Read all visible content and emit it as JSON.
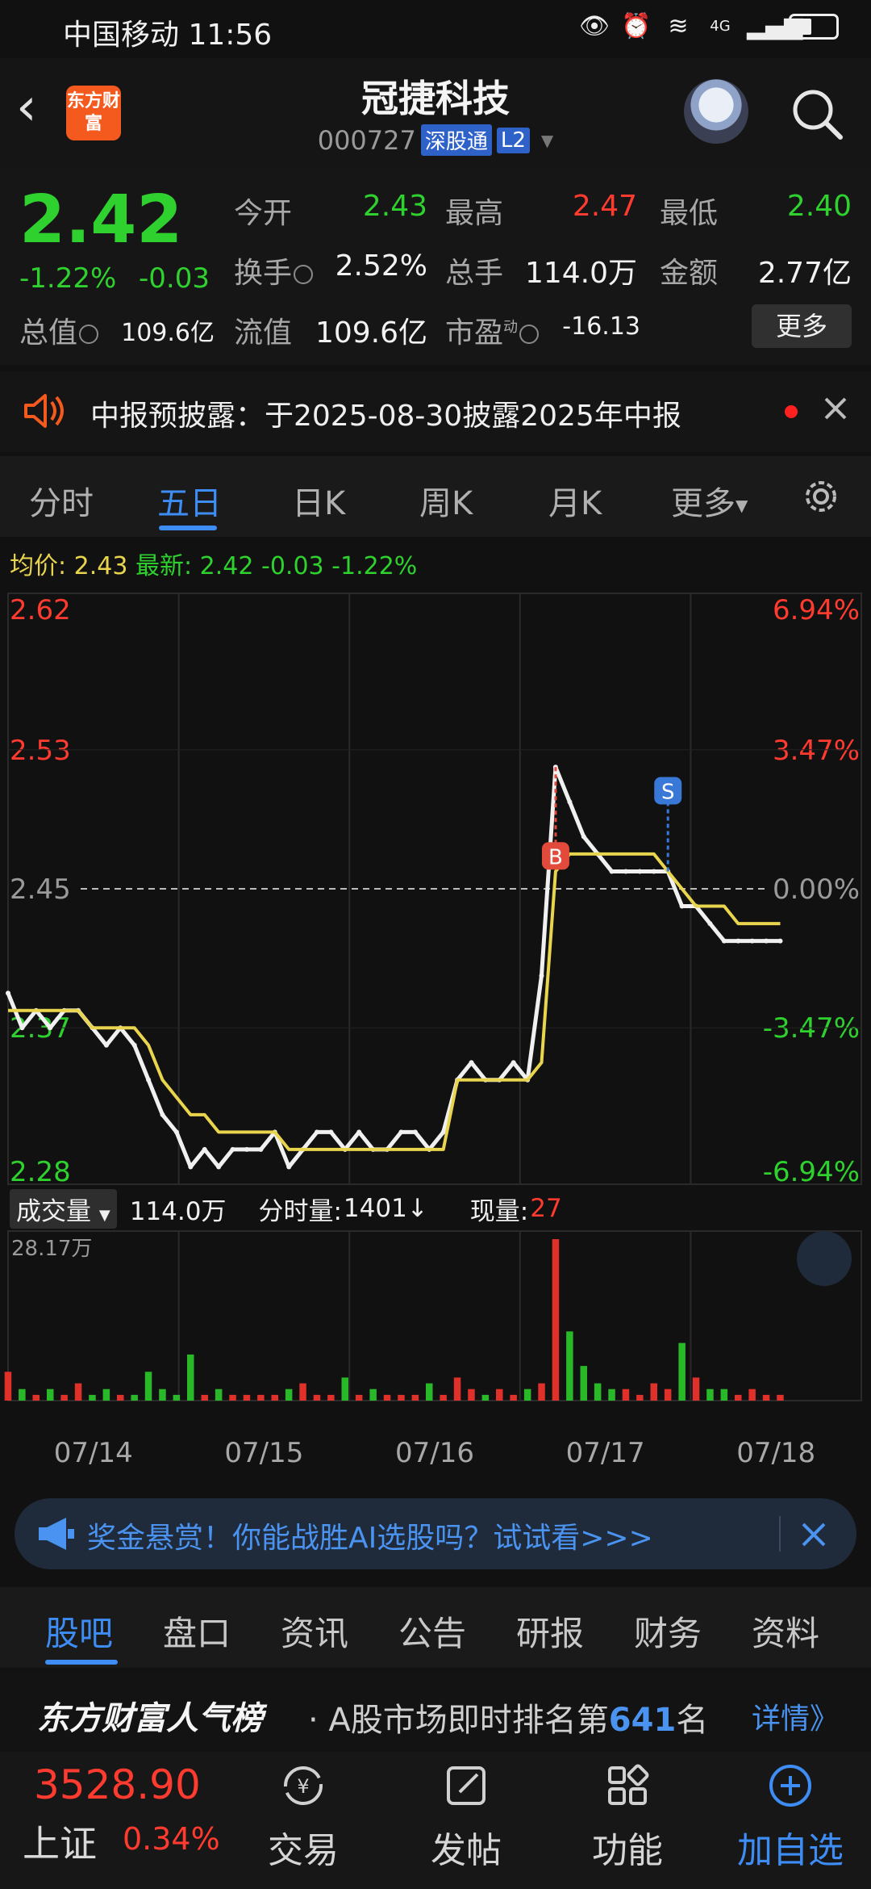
{
  "status_bar": {
    "carrier_time": "中国移动 11:56",
    "network": "4G"
  },
  "header": {
    "logo_text": "东方财富",
    "stock_name": "冠捷科技",
    "stock_code": "000727",
    "tag_connect": "深股通",
    "tag_level": "L2"
  },
  "quote": {
    "last": "2.42",
    "pct": "-1.22%",
    "chg": "-0.03",
    "open_label": "今开",
    "open": "2.43",
    "high_label": "最高",
    "high": "2.47",
    "low_label": "最低",
    "low": "2.40",
    "turnover_label": "换手",
    "turnover": "2.52%",
    "volume_label": "总手",
    "volume": "114.0万",
    "amount_label": "金额",
    "amount": "2.77亿",
    "mktcap_label": "总值",
    "mktcap": "109.6亿",
    "float_label": "流值",
    "float": "109.6亿",
    "pe_label": "市盈",
    "pe_sup": "动",
    "pe": "-16.13",
    "more_label": "更多"
  },
  "notice": {
    "text": "中报预披露：于2025-08-30披露2025年中报"
  },
  "chart_tabs": [
    {
      "label": "分时"
    },
    {
      "label": "五日"
    },
    {
      "label": "日K"
    },
    {
      "label": "周K"
    },
    {
      "label": "月K"
    },
    {
      "label": "更多"
    }
  ],
  "avg_row": {
    "avg_label": "均价:",
    "avg": "2.43",
    "latest_label": "最新:",
    "latest": "2.42",
    "chg": "-0.03",
    "pct": "-1.22%"
  },
  "chart_data": {
    "type": "line",
    "title": "",
    "y_left_ticks": [
      "2.62",
      "2.53",
      "2.45",
      "2.37",
      "2.28"
    ],
    "y_right_ticks": [
      "6.94%",
      "3.47%",
      "0.00%",
      "-3.47%",
      "-6.94%"
    ],
    "ylim": [
      2.28,
      2.62
    ],
    "prev_close": 2.45,
    "x_dates": [
      "07/14",
      "07/15",
      "07/16",
      "07/17",
      "07/18"
    ],
    "series": [
      {
        "color": "#f0f0f0",
        "values": [
          2.39,
          2.37,
          2.38,
          2.37,
          2.38,
          2.38,
          2.37,
          2.36,
          2.37,
          2.36,
          2.34,
          2.32,
          2.31,
          2.29,
          2.3,
          2.29,
          2.3,
          2.3,
          2.3,
          2.31,
          2.29,
          2.3,
          2.31,
          2.31,
          2.3,
          2.31,
          2.3,
          2.3,
          2.31,
          2.31,
          2.3,
          2.31,
          2.34,
          2.35,
          2.34,
          2.34,
          2.35,
          2.34,
          2.4,
          2.52,
          2.5,
          2.48,
          2.47,
          2.46,
          2.46,
          2.46,
          2.46,
          2.46,
          2.44,
          2.44,
          2.43,
          2.42,
          2.42,
          2.42,
          2.42,
          2.42
        ]
      },
      {
        "color": "#e8d44d",
        "values": [
          2.38,
          2.38,
          2.38,
          2.38,
          2.38,
          2.38,
          2.37,
          2.37,
          2.37,
          2.37,
          2.36,
          2.34,
          2.33,
          2.32,
          2.32,
          2.31,
          2.31,
          2.31,
          2.31,
          2.31,
          2.3,
          2.3,
          2.3,
          2.3,
          2.3,
          2.3,
          2.3,
          2.3,
          2.3,
          2.3,
          2.3,
          2.3,
          2.34,
          2.34,
          2.34,
          2.34,
          2.34,
          2.34,
          2.35,
          2.46,
          2.47,
          2.47,
          2.47,
          2.47,
          2.47,
          2.47,
          2.47,
          2.46,
          2.45,
          2.44,
          2.44,
          2.44,
          2.43,
          2.43,
          2.43,
          2.43
        ]
      }
    ],
    "markers": [
      {
        "label": "B",
        "index": 39,
        "value": 2.52
      },
      {
        "label": "S",
        "index": 47,
        "value": 2.46
      }
    ],
    "volume": {
      "max_label": "28.17万",
      "values": [
        5,
        2,
        1,
        2,
        1,
        3,
        1,
        2,
        1,
        1,
        5,
        2,
        1,
        8,
        1,
        2,
        1,
        1,
        1,
        1,
        2,
        3,
        1,
        1,
        4,
        1,
        2,
        1,
        1,
        1,
        3,
        1,
        4,
        2,
        1,
        2,
        1,
        2,
        3,
        28,
        12,
        6,
        3,
        2,
        2,
        1,
        3,
        2,
        10,
        4,
        2,
        2,
        1,
        2,
        1,
        1
      ]
    }
  },
  "volume_header": {
    "type_label": "成交量",
    "total": "114.0万",
    "tick_label": "分时量:",
    "tick": "1401↓",
    "now_label": "现量:",
    "now": "27"
  },
  "ai_banner": {
    "text": "奖金悬赏！你能战胜AI选股吗？试试看>>>"
  },
  "content_tabs": [
    {
      "label": "股吧"
    },
    {
      "label": "盘口"
    },
    {
      "label": "资讯"
    },
    {
      "label": "公告"
    },
    {
      "label": "研报"
    },
    {
      "label": "财务"
    },
    {
      "label": "资料"
    }
  ],
  "rank": {
    "brand": "东方财富人气榜",
    "prefix": "· A股市场即时排名第",
    "num": "641",
    "suffix": "名",
    "detail": "详情》"
  },
  "bottom_nav": {
    "index_value": "3528.90",
    "index_name": "上证",
    "index_pct": "0.34%",
    "items": [
      {
        "label": "交易"
      },
      {
        "label": "发帖"
      },
      {
        "label": "功能"
      },
      {
        "label": "加自选"
      }
    ]
  },
  "colors": {
    "up": "#ff3b30",
    "down": "#2fd12f",
    "accent": "#3d8df5"
  }
}
